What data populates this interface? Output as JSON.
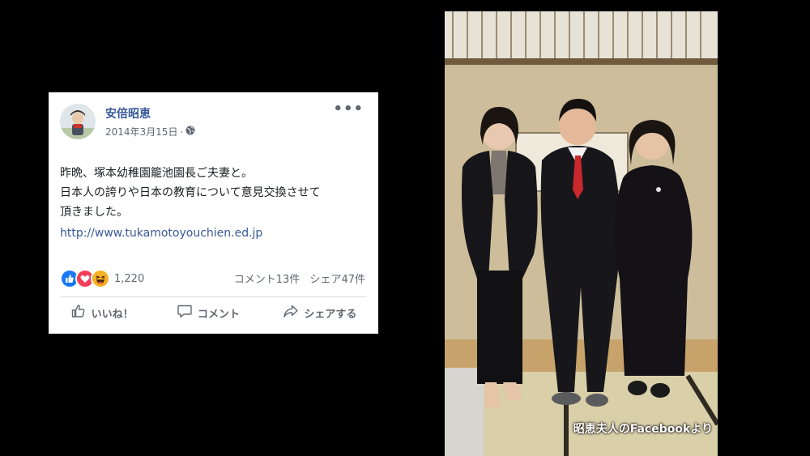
{
  "post": {
    "author": "安倍昭恵",
    "date": "2014年3月15日",
    "date_separator": "·",
    "privacy_icon": "globe-icon",
    "more_icon": "ellipsis-icon",
    "more_label": "•••",
    "text_lines": [
      "昨晩、塚本幼稚園籠池園長ご夫妻と。",
      "日本人の誇りや日本の教育について意見交換させて",
      "頂きました。"
    ],
    "link": "http://www.tukamotoyouchien.ed.jp",
    "reactions": {
      "icons": [
        "like-icon",
        "love-icon",
        "haha-icon"
      ],
      "count": "1,220"
    },
    "comments": "コメント13件",
    "shares": "シェア47件",
    "actions": {
      "like": "いいね！",
      "comment": "コメント",
      "share": "シェアする"
    }
  },
  "photo": {
    "caption": "昭恵夫人のFacebookより"
  },
  "colors": {
    "background": "#000000",
    "card": "#ffffff",
    "author_link": "#385898",
    "secondary_text": "#606770",
    "like_blue": "#1877f2",
    "love_red": "#f33e58",
    "haha_yellow": "#f7b125"
  }
}
